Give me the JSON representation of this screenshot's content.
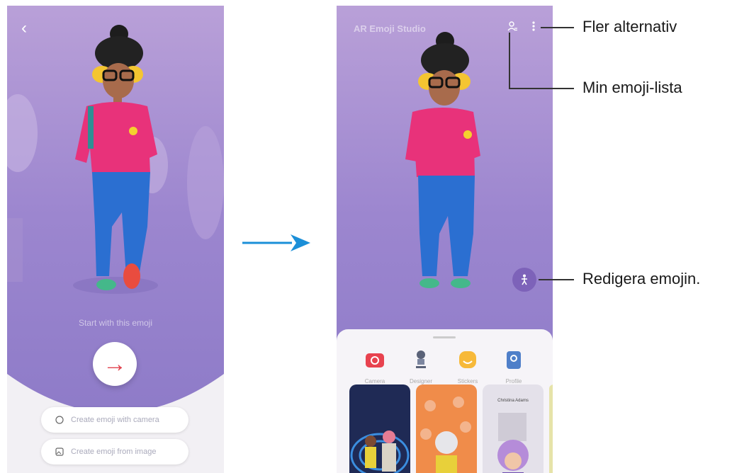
{
  "screen1": {
    "back_label": "‹",
    "hint_text": "Start with this emoji",
    "go_label": "→",
    "create_with_camera": "Create emoji with camera",
    "create_from_image": "Create emoji from image"
  },
  "screen2": {
    "title": "AR Emoji Studio",
    "my_emoji_list_icon": "person-list-icon",
    "more_options_icon": "more-vertical-icon",
    "edit_icon": "figure-icon",
    "actions": [
      {
        "label": "Camera",
        "icon": "camera-icon",
        "color": "#e8424f"
      },
      {
        "label": "Designer",
        "icon": "designer-icon",
        "color": "#5a6278"
      },
      {
        "label": "Stickers",
        "icon": "sticker-icon",
        "color": "#f7b93a"
      },
      {
        "label": "Profile",
        "icon": "profile-icon",
        "color": "#4f7fc9"
      }
    ],
    "card3_text": "Christina Adams"
  },
  "callouts": {
    "more_options": "Fler alternativ",
    "my_emoji_list": "Min emoji-lista",
    "edit_emoji": "Redigera emojin."
  },
  "arrow_color": "#1b8fd8"
}
